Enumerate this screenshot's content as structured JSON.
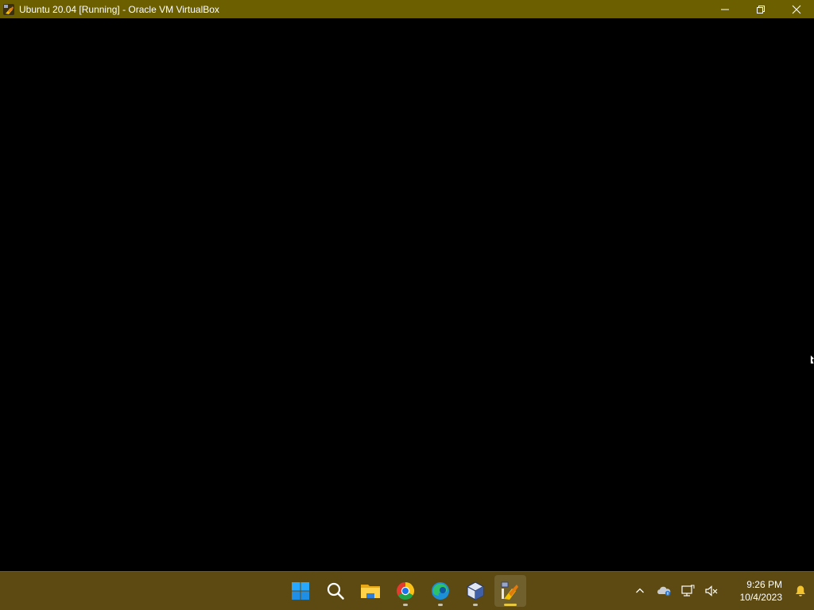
{
  "window": {
    "title": "Ubuntu 20.04 [Running] - Oracle VM VirtualBox",
    "icon": "virtualbox-vm-icon",
    "controls": [
      "minimize-icon",
      "restore-icon",
      "close-icon"
    ],
    "titlebar_color": "#6b5f00"
  },
  "vm_display": {
    "background_color": "#000000",
    "cursor_icon": "mouse-pointer-icon"
  },
  "taskbar": {
    "background_color": "#5c4a12",
    "apps": [
      {
        "name": "start",
        "icon": "windows-start-icon",
        "running": false
      },
      {
        "name": "search",
        "icon": "search-icon",
        "running": false
      },
      {
        "name": "file-explorer",
        "icon": "folder-icon",
        "running": false
      },
      {
        "name": "chrome",
        "icon": "chrome-icon",
        "running": true
      },
      {
        "name": "edge",
        "icon": "edge-icon",
        "running": true
      },
      {
        "name": "virtualbox-manager",
        "icon": "virtualbox-icon",
        "running": true
      },
      {
        "name": "ubuntu-vm",
        "icon": "virtualbox-vm-icon",
        "running": true,
        "active": true
      }
    ],
    "tray": {
      "icons": [
        "chevron-up-icon",
        "onedrive-icon",
        "network-icon",
        "volume-muted-icon"
      ],
      "time": "9:26 PM",
      "date": "10/4/2023",
      "notification_icon": "bell-icon",
      "accent_color": "#e8c840"
    }
  }
}
